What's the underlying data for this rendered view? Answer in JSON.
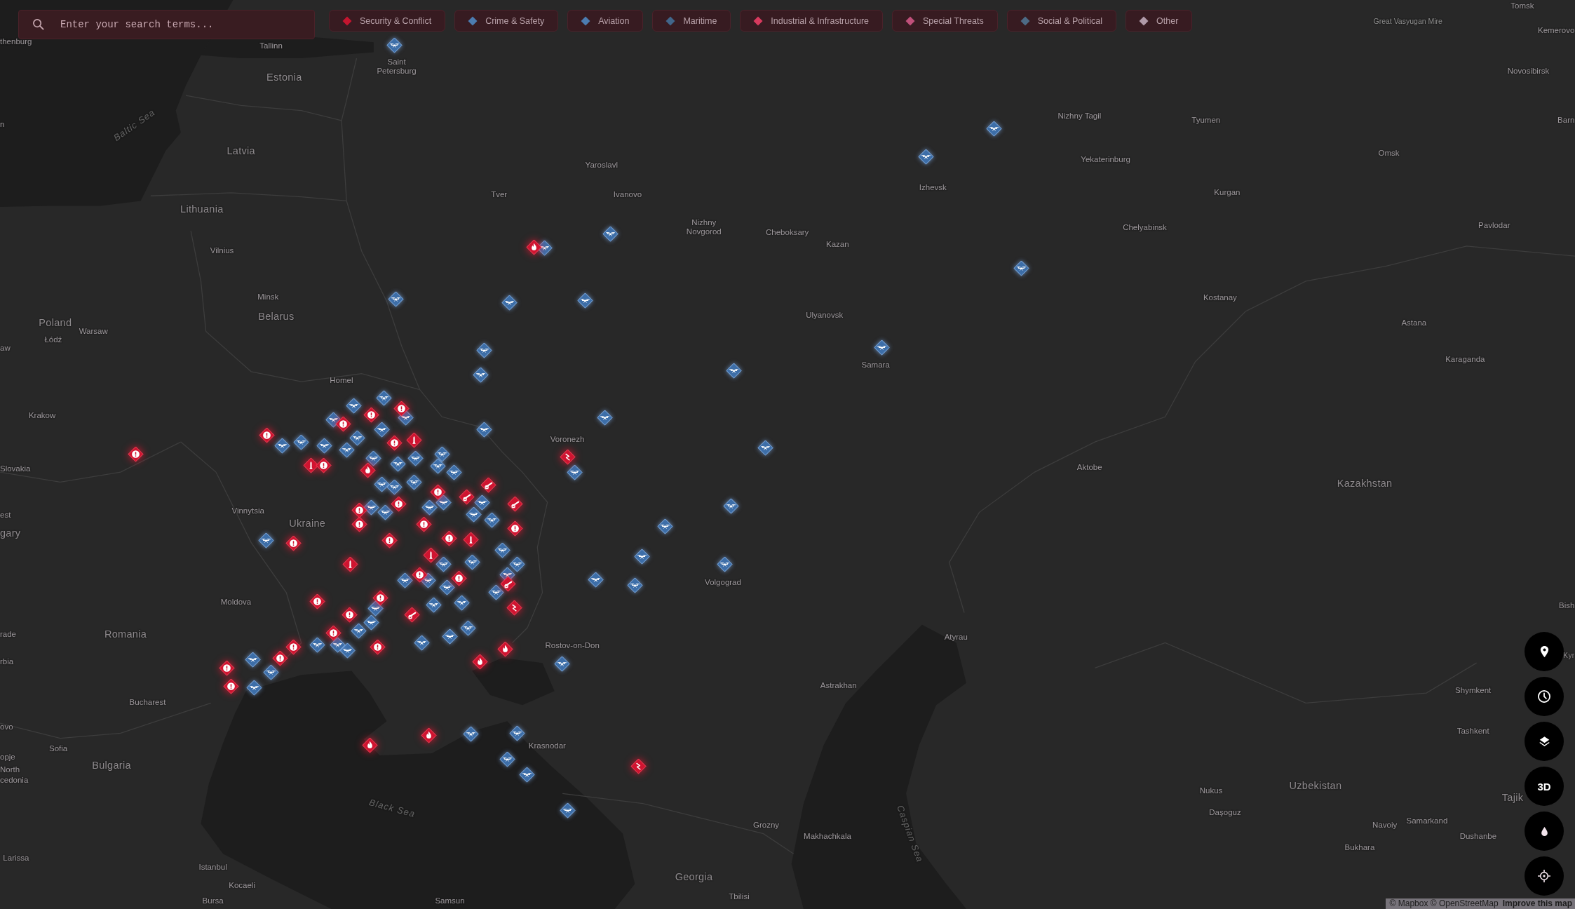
{
  "search": {
    "placeholder": "Enter your search terms..."
  },
  "filters": [
    {
      "label": "Security & Conflict",
      "color": "#c4152f"
    },
    {
      "label": "Crime & Safety",
      "color": "#4c7cb0"
    },
    {
      "label": "Aviation",
      "color": "#4c7cb0"
    },
    {
      "label": "Maritime",
      "color": "#41668a"
    },
    {
      "label": "Industrial & Infrastructure",
      "color": "#d83a5e"
    },
    {
      "label": "Special Threats",
      "color": "#c0507a"
    },
    {
      "label": "Social & Political",
      "color": "#4d6a85"
    },
    {
      "label": "Other",
      "color": "#b09aa8"
    }
  ],
  "map": {
    "labels": [
      {
        "text": "Tomsk",
        "kind": "city"
      },
      {
        "text": "Great Vasyugan Mire",
        "kind": "region"
      },
      {
        "text": "Kemerovo",
        "kind": "city"
      },
      {
        "text": "thenburg",
        "kind": "city"
      },
      {
        "text": "Tallinn",
        "kind": "city"
      },
      {
        "text": "Saint Petersburg",
        "kind": "city"
      },
      {
        "text": "Novosibirsk",
        "kind": "city"
      },
      {
        "text": "Estonia",
        "kind": "country"
      },
      {
        "text": "n",
        "kind": "city"
      },
      {
        "text": "Baltic Sea",
        "kind": "sea"
      },
      {
        "text": "Nizhny Tagil",
        "kind": "city"
      },
      {
        "text": "Tyumen",
        "kind": "city"
      },
      {
        "text": "Barn",
        "kind": "city"
      },
      {
        "text": "Latvia",
        "kind": "country"
      },
      {
        "text": "Yekaterinburg",
        "kind": "city"
      },
      {
        "text": "Omsk",
        "kind": "city"
      },
      {
        "text": "Yaroslavl",
        "kind": "city"
      },
      {
        "text": "Tver",
        "kind": "city"
      },
      {
        "text": "Ivanovo",
        "kind": "city"
      },
      {
        "text": "Izhevsk",
        "kind": "city"
      },
      {
        "text": "Kurgan",
        "kind": "city"
      },
      {
        "text": "Lithuania",
        "kind": "country"
      },
      {
        "text": "Nizhny Novgorod",
        "kind": "city"
      },
      {
        "text": "Cheboksary",
        "kind": "city"
      },
      {
        "text": "Chelyabinsk",
        "kind": "city"
      },
      {
        "text": "Pavlodar",
        "kind": "city"
      },
      {
        "text": "Vilnius",
        "kind": "city"
      },
      {
        "text": "Kazan",
        "kind": "city"
      },
      {
        "text": "Minsk",
        "kind": "city"
      },
      {
        "text": "Kostanay",
        "kind": "city"
      },
      {
        "text": "Poland",
        "kind": "country"
      },
      {
        "text": "Belarus",
        "kind": "country"
      },
      {
        "text": "Ulyanovsk",
        "kind": "city"
      },
      {
        "text": "Astana",
        "kind": "city"
      },
      {
        "text": "Warsaw",
        "kind": "city"
      },
      {
        "text": "Łódź",
        "kind": "city"
      },
      {
        "text": "aw",
        "kind": "city"
      },
      {
        "text": "Samara",
        "kind": "city"
      },
      {
        "text": "Karaganda",
        "kind": "city"
      },
      {
        "text": "Homel",
        "kind": "city"
      },
      {
        "text": "Krakow",
        "kind": "city"
      },
      {
        "text": "Voronezh",
        "kind": "city"
      },
      {
        "text": "Slovakia",
        "kind": "city"
      },
      {
        "text": "Aktobe",
        "kind": "city"
      },
      {
        "text": "Kazakhstan",
        "kind": "country"
      },
      {
        "text": "est",
        "kind": "city"
      },
      {
        "text": "Vinnytsia",
        "kind": "city"
      },
      {
        "text": "Ukraine",
        "kind": "country"
      },
      {
        "text": "gary",
        "kind": "country"
      },
      {
        "text": "Volgograd",
        "kind": "city"
      },
      {
        "text": "Moldova",
        "kind": "city"
      },
      {
        "text": "Bish",
        "kind": "city"
      },
      {
        "text": "rade",
        "kind": "city"
      },
      {
        "text": "Romania",
        "kind": "country"
      },
      {
        "text": "Atyrau",
        "kind": "city"
      },
      {
        "text": "Rostov-on-Don",
        "kind": "city"
      },
      {
        "text": "Kyr",
        "kind": "country"
      },
      {
        "text": "rbia",
        "kind": "city"
      },
      {
        "text": "Astrakhan",
        "kind": "city"
      },
      {
        "text": "Shymkent",
        "kind": "city"
      },
      {
        "text": "Bucharest",
        "kind": "city"
      },
      {
        "text": "ovo",
        "kind": "city"
      },
      {
        "text": "Tashkent",
        "kind": "city"
      },
      {
        "text": "Sofia",
        "kind": "city"
      },
      {
        "text": "Krasnodar",
        "kind": "city"
      },
      {
        "text": "opje",
        "kind": "city"
      },
      {
        "text": "North",
        "kind": "city"
      },
      {
        "text": "Bulgaria",
        "kind": "country"
      },
      {
        "text": "cedonia",
        "kind": "city"
      },
      {
        "text": "Uzbekistan",
        "kind": "country"
      },
      {
        "text": "Nukus",
        "kind": "city"
      },
      {
        "text": "Tajik",
        "kind": "country"
      },
      {
        "text": "Black Sea",
        "kind": "sea"
      },
      {
        "text": "Daşoguz",
        "kind": "city"
      },
      {
        "text": "Grozny",
        "kind": "city"
      },
      {
        "text": "Navoiy",
        "kind": "city"
      },
      {
        "text": "Samarkand",
        "kind": "city"
      },
      {
        "text": "Makhachkala",
        "kind": "city"
      },
      {
        "text": "Caspian Sea",
        "kind": "sea"
      },
      {
        "text": "Dushanbe",
        "kind": "city"
      },
      {
        "text": "Bukhara",
        "kind": "city"
      },
      {
        "text": "Larissa",
        "kind": "city"
      },
      {
        "text": "Istanbul",
        "kind": "city"
      },
      {
        "text": "Georgia",
        "kind": "country"
      },
      {
        "text": "Kocaeli",
        "kind": "city"
      },
      {
        "text": "Tbilisi",
        "kind": "city"
      },
      {
        "text": "Bursa",
        "kind": "city"
      },
      {
        "text": "Samsun",
        "kind": "city"
      }
    ],
    "markers": [
      {
        "kind": "drone"
      },
      {
        "kind": "drone"
      },
      {
        "kind": "drone"
      },
      {
        "kind": "drone"
      },
      {
        "kind": "drone"
      },
      {
        "kind": "drone"
      },
      {
        "kind": "drone"
      },
      {
        "kind": "drone"
      },
      {
        "kind": "drone"
      },
      {
        "kind": "drone"
      },
      {
        "kind": "drone"
      },
      {
        "kind": "drone"
      },
      {
        "kind": "drone"
      },
      {
        "kind": "drone"
      },
      {
        "kind": "drone"
      },
      {
        "kind": "drone"
      },
      {
        "kind": "drone"
      },
      {
        "kind": "drone"
      },
      {
        "kind": "drone"
      },
      {
        "kind": "drone"
      },
      {
        "kind": "drone"
      },
      {
        "kind": "drone"
      },
      {
        "kind": "drone"
      },
      {
        "kind": "drone"
      },
      {
        "kind": "drone"
      },
      {
        "kind": "drone"
      },
      {
        "kind": "drone"
      },
      {
        "kind": "drone"
      },
      {
        "kind": "drone"
      },
      {
        "kind": "drone"
      },
      {
        "kind": "drone"
      },
      {
        "kind": "drone"
      },
      {
        "kind": "drone"
      },
      {
        "kind": "alert"
      },
      {
        "kind": "fire"
      },
      {
        "kind": "strike"
      },
      {
        "kind": "strike"
      },
      {
        "kind": "fire"
      },
      {
        "kind": "fire"
      },
      {
        "kind": "fire"
      },
      {
        "kind": "fire"
      },
      {
        "kind": "alert"
      },
      {
        "kind": "alert"
      },
      {
        "kind": "alert"
      },
      {
        "kind": "alert"
      },
      {
        "kind": "alert"
      },
      {
        "kind": "alert"
      },
      {
        "kind": "missile"
      },
      {
        "kind": "alert"
      },
      {
        "kind": "drone"
      },
      {
        "kind": "drone"
      },
      {
        "kind": "drone"
      },
      {
        "kind": "drone"
      },
      {
        "kind": "drone"
      },
      {
        "kind": "drone"
      },
      {
        "kind": "drone"
      },
      {
        "kind": "drone"
      },
      {
        "kind": "drone"
      },
      {
        "kind": "drone"
      },
      {
        "kind": "drone"
      },
      {
        "kind": "drone"
      },
      {
        "kind": "drone"
      },
      {
        "kind": "drone"
      },
      {
        "kind": "drone"
      },
      {
        "kind": "drone"
      },
      {
        "kind": "drone"
      },
      {
        "kind": "drone"
      },
      {
        "kind": "drone"
      },
      {
        "kind": "drone"
      },
      {
        "kind": "drone"
      },
      {
        "kind": "drone"
      },
      {
        "kind": "drone"
      },
      {
        "kind": "drone"
      },
      {
        "kind": "drone"
      },
      {
        "kind": "drone"
      },
      {
        "kind": "drone"
      },
      {
        "kind": "drone"
      },
      {
        "kind": "drone"
      },
      {
        "kind": "drone"
      },
      {
        "kind": "drone"
      },
      {
        "kind": "drone"
      },
      {
        "kind": "drone"
      },
      {
        "kind": "drone"
      },
      {
        "kind": "drone"
      },
      {
        "kind": "drone"
      },
      {
        "kind": "drone"
      },
      {
        "kind": "drone"
      },
      {
        "kind": "drone"
      },
      {
        "kind": "drone"
      },
      {
        "kind": "drone"
      },
      {
        "kind": "drone"
      },
      {
        "kind": "drone"
      },
      {
        "kind": "drone"
      },
      {
        "kind": "drone"
      },
      {
        "kind": "drone"
      },
      {
        "kind": "alert"
      },
      {
        "kind": "alert"
      },
      {
        "kind": "alert"
      },
      {
        "kind": "alert"
      },
      {
        "kind": "missile"
      },
      {
        "kind": "missile"
      },
      {
        "kind": "alert"
      },
      {
        "kind": "fire"
      },
      {
        "kind": "alert"
      },
      {
        "kind": "alert"
      },
      {
        "kind": "alert"
      },
      {
        "kind": "alert"
      },
      {
        "kind": "alert"
      },
      {
        "kind": "alert"
      },
      {
        "kind": "missile"
      },
      {
        "kind": "alert"
      },
      {
        "kind": "artillery"
      },
      {
        "kind": "artillery"
      },
      {
        "kind": "artillery"
      },
      {
        "kind": "missile"
      },
      {
        "kind": "alert"
      },
      {
        "kind": "alert"
      },
      {
        "kind": "artillery"
      },
      {
        "kind": "strike"
      },
      {
        "kind": "alert"
      },
      {
        "kind": "alert"
      },
      {
        "kind": "alert"
      },
      {
        "kind": "alert"
      },
      {
        "kind": "artillery"
      },
      {
        "kind": "alert"
      }
    ]
  },
  "map_controls": [
    {
      "kind": "pin"
    },
    {
      "kind": "clock"
    },
    {
      "kind": "layers"
    },
    {
      "kind": "text",
      "label": "3D"
    },
    {
      "kind": "drop"
    },
    {
      "kind": "locate"
    }
  ],
  "attribution": {
    "text": "© Mapbox © OpenStreetMap",
    "link": "Improve this map"
  }
}
